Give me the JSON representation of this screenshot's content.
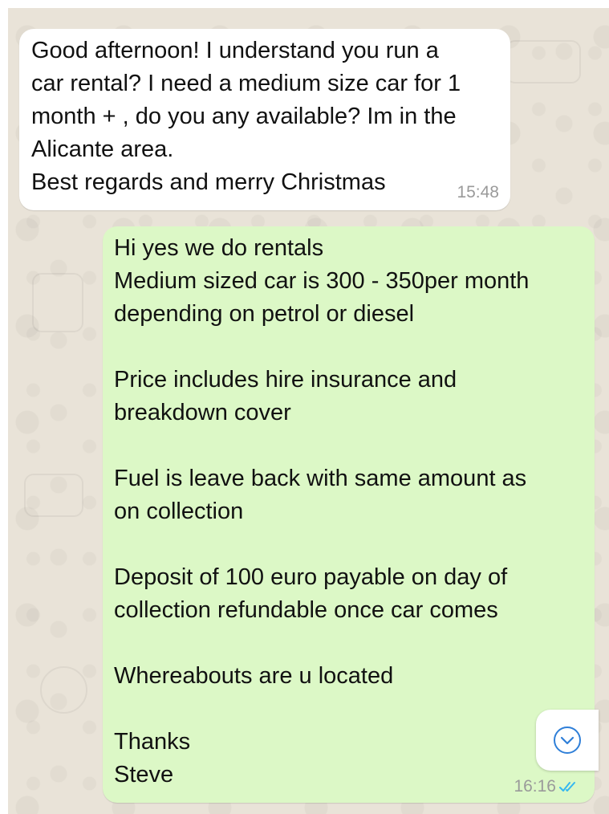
{
  "messages": [
    {
      "direction": "incoming",
      "text": "Good afternoon! I understand you run a\ncar rental? I need a medium size car for 1\nmonth + , do you any available? Im in the\nAlicante area.\nBest regards and merry Christmas",
      "time": "15:48"
    },
    {
      "direction": "outgoing",
      "text": "Hi yes we do rentals\nMedium sized car is 300 - 350per month\ndepending on petrol or diesel\n\nPrice includes hire insurance and\nbreakdown cover\n\nFuel is leave back with same amount as\non collection\n\nDeposit of 100 euro payable on day of\ncollection refundable once car comes\n\nWhereabouts are u located\n\nThanks\nSteve",
      "time": "16:16",
      "status_icon": "double-check-read-icon"
    }
  ],
  "scroll_button": {
    "icon": "chevron-down-circle-icon"
  },
  "colors": {
    "chat_background": "#e9e3d8",
    "incoming_bubble": "#ffffff",
    "outgoing_bubble": "#dcf8c6",
    "read_tick": "#34b7f1",
    "scroll_icon": "#2f7fd8"
  }
}
